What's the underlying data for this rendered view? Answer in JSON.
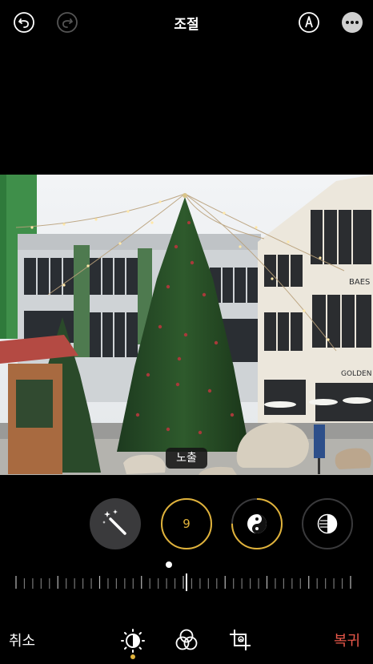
{
  "header": {
    "title": "조절",
    "undo_icon": "undo-icon",
    "redo_icon": "redo-icon",
    "markup_icon": "markup-pen-icon",
    "more_icon": "more-ellipsis-icon"
  },
  "photo": {
    "signs": [
      "BAES",
      "GOLDEN"
    ]
  },
  "adjust": {
    "active_tool_label": "노출",
    "tools": [
      {
        "name": "auto-enhance",
        "icon": "magic-wand-icon"
      },
      {
        "name": "exposure",
        "value": "9",
        "progress": 0.09
      },
      {
        "name": "brilliance",
        "icon": "yin-yang-icon",
        "progress": 0.75
      },
      {
        "name": "highlights",
        "icon": "highlights-icon",
        "progress": 0.0
      }
    ],
    "slider_value": 9
  },
  "footer": {
    "cancel_label": "취소",
    "revert_label": "복귀",
    "tabs": [
      "adjust-icon",
      "filters-icon",
      "crop-icon"
    ]
  },
  "colors": {
    "accent": "#e0b23a",
    "revert": "#e8574a",
    "tool_bg": "#3a3a3c"
  }
}
